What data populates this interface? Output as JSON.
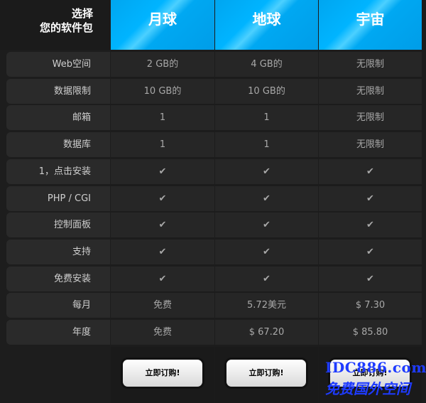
{
  "header": {
    "label_line1": "选择",
    "label_line2": "您的软件包",
    "plans": [
      "月球",
      "地球",
      "宇宙"
    ]
  },
  "rows": [
    {
      "label": "Web空间",
      "values": [
        "2 GB的",
        "4 GB的",
        "无限制"
      ]
    },
    {
      "label": "数据限制",
      "values": [
        "10 GB的",
        "10 GB的",
        "无限制"
      ]
    },
    {
      "label": "邮箱",
      "values": [
        "1",
        "1",
        "无限制"
      ]
    },
    {
      "label": "数据库",
      "values": [
        "1",
        "1",
        "无限制"
      ]
    },
    {
      "label": "1，点击安装",
      "values": [
        "✔",
        "✔",
        "✔"
      ]
    },
    {
      "label": "PHP / CGI",
      "values": [
        "✔",
        "✔",
        "✔"
      ]
    },
    {
      "label": "控制面板",
      "values": [
        "✔",
        "✔",
        "✔"
      ]
    },
    {
      "label": "支持",
      "values": [
        "✔",
        "✔",
        "✔"
      ]
    },
    {
      "label": "免费安装",
      "values": [
        "✔",
        "✔",
        "✔"
      ]
    },
    {
      "label": "每月",
      "values": [
        "免费",
        "5.72美元",
        "$ 7.30"
      ]
    },
    {
      "label": "年度",
      "values": [
        "免费",
        "$ 67.20",
        "$ 85.80"
      ]
    }
  ],
  "buttons": [
    "立即订购!",
    "立即订购!",
    "立即订购!"
  ],
  "watermark": {
    "line1": "IDC886.com",
    "line2": "免费国外空间"
  },
  "colors": {
    "header_blue": "#00a6f0",
    "check": "#27b6f2"
  }
}
